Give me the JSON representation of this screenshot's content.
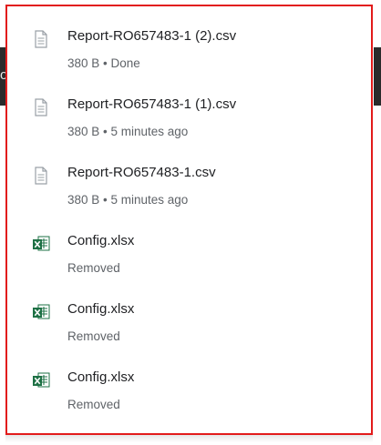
{
  "colors": {
    "panel_border": "#e21b1b",
    "file_name_text": "#202124",
    "status_text": "#5f6368",
    "excel_green": "#1d7044",
    "doc_icon_gray": "#9aa0a6"
  },
  "backdrop": {
    "left_glyph": "or"
  },
  "downloads": [
    {
      "icon": "document-icon",
      "name": "Report-RO657483-1 (2).csv",
      "status": "380 B • Done"
    },
    {
      "icon": "document-icon",
      "name": "Report-RO657483-1 (1).csv",
      "status": "380 B • 5 minutes ago"
    },
    {
      "icon": "document-icon",
      "name": "Report-RO657483-1.csv",
      "status": "380 B • 5 minutes ago"
    },
    {
      "icon": "excel-icon",
      "name": "Config.xlsx",
      "status": "Removed"
    },
    {
      "icon": "excel-icon",
      "name": "Config.xlsx",
      "status": "Removed"
    },
    {
      "icon": "excel-icon",
      "name": "Config.xlsx",
      "status": "Removed"
    }
  ]
}
